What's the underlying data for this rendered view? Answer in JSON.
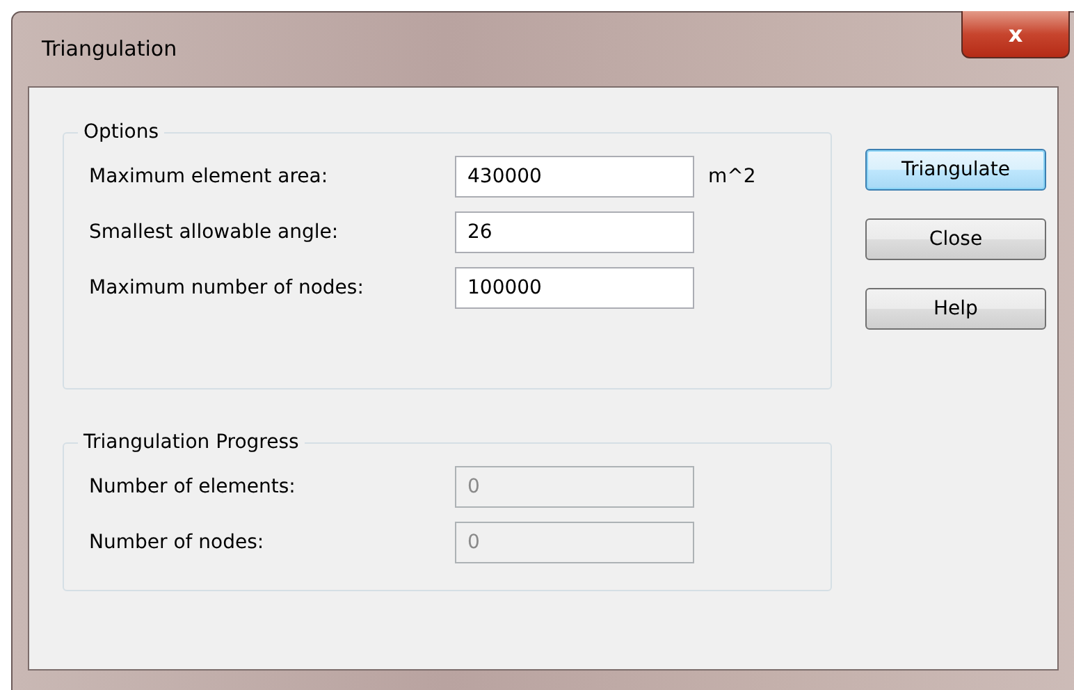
{
  "window": {
    "title": "Triangulation",
    "close_label": "x"
  },
  "groups": [
    {
      "title": "Options",
      "fields": [
        {
          "label": "Maximum element area:",
          "value": "430000",
          "unit": "m^2",
          "disabled": false
        },
        {
          "label": "Smallest allowable angle:",
          "value": "26",
          "disabled": false
        },
        {
          "label": "Maximum number of nodes:",
          "value": "100000",
          "disabled": false
        }
      ]
    },
    {
      "title": "Triangulation Progress",
      "fields": [
        {
          "label": "Number of elements:",
          "value": "0",
          "disabled": true
        },
        {
          "label": "Number of nodes:",
          "value": "0",
          "disabled": true
        }
      ]
    }
  ],
  "buttons": [
    {
      "label": "Triangulate",
      "default": true
    },
    {
      "label": "Close",
      "default": false
    },
    {
      "label": "Help",
      "default": false
    }
  ]
}
